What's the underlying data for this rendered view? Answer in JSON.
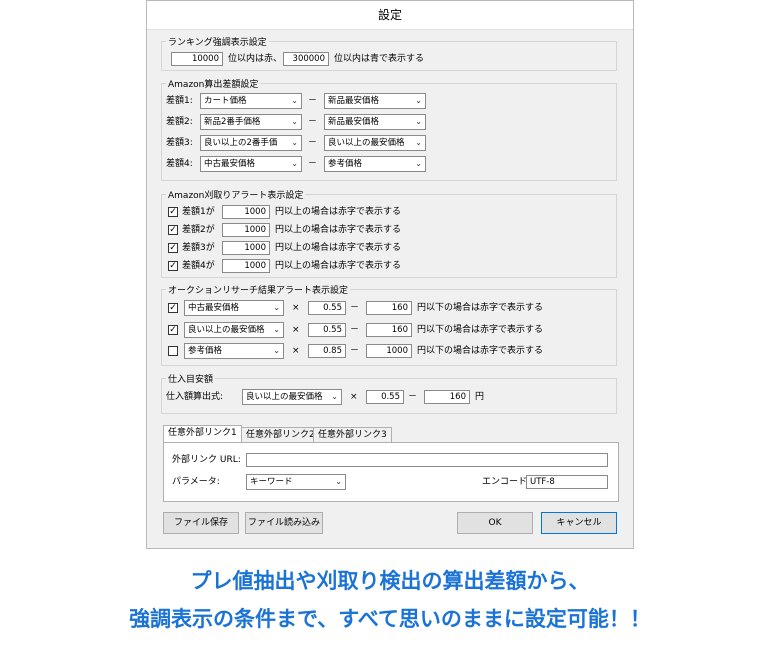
{
  "dialog": {
    "title": "設定"
  },
  "ranking": {
    "legend": "ランキング強調表示設定",
    "red_value": "10000",
    "red_text": "位以内は赤、",
    "blue_value": "300000",
    "blue_text": "位以内は青で表示する"
  },
  "amazon_diff": {
    "legend": "Amazon算出差額設定",
    "dash": "－",
    "rows": [
      {
        "label": "差額1:",
        "left": "カート価格",
        "right": "新品最安価格"
      },
      {
        "label": "差額2:",
        "left": "新品2番手価格",
        "right": "新品最安価格"
      },
      {
        "label": "差額3:",
        "left": "良い以上の2番手価",
        "right": "良い以上の最安価格"
      },
      {
        "label": "差額4:",
        "left": "中古最安価格",
        "right": "参考価格"
      }
    ]
  },
  "alert": {
    "legend": "Amazon刈取りアラート表示設定",
    "suffix": "円以上の場合は赤字で表示する",
    "rows": [
      {
        "label": "差額1が",
        "value": "1000",
        "checked": "✓"
      },
      {
        "label": "差額2が",
        "value": "1000",
        "checked": "✓"
      },
      {
        "label": "差額3が",
        "value": "1000",
        "checked": "✓"
      },
      {
        "label": "差額4が",
        "value": "1000",
        "checked": "✓"
      }
    ]
  },
  "auction": {
    "legend": "オークションリサーチ結果アラート表示設定",
    "times": "×",
    "dash": "－",
    "suffix": "円以下の場合は赤字で表示する",
    "rows": [
      {
        "checked": "✓",
        "select": "中古最安価格",
        "mult": "0.55",
        "minus": "160"
      },
      {
        "checked": "✓",
        "select": "良い以上の最安価格",
        "mult": "0.55",
        "minus": "160"
      },
      {
        "checked": "",
        "select": "参考価格",
        "mult": "0.85",
        "minus": "1000"
      }
    ]
  },
  "purchase": {
    "legend": "仕入目安額",
    "label": "仕入額算出式:",
    "select": "良い以上の最安価格",
    "times": "×",
    "mult": "0.55",
    "dash": "－",
    "minus": "160",
    "unit": "円"
  },
  "tabs": [
    "任意外部リンク1",
    "任意外部リンク2",
    "任意外部リンク3"
  ],
  "link": {
    "url_label": "外部リンク URL:",
    "url_value": "",
    "param_label": "パラメータ:",
    "param_value": "キーワード",
    "encode_label": "エンコード:",
    "encode_value": "UTF-8"
  },
  "buttons": {
    "save": "ファイル保存",
    "load": "ファイル読み込み",
    "ok": "OK",
    "cancel": "キャンセル"
  },
  "caption": {
    "line1": "プレ値抽出や刈取り検出の算出差額から、",
    "line2": "強調表示の条件まで、すべて思いのままに設定可能！！",
    "color": "#1b73d6"
  },
  "colors": {
    "dialog_bg": "#f0f0f0",
    "default_button_border": "#0078d7"
  }
}
